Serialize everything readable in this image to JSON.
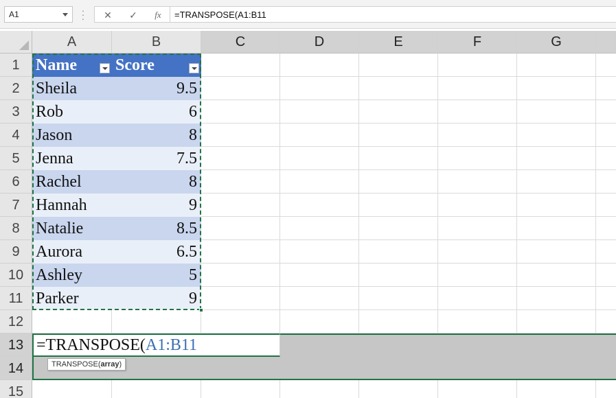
{
  "formula_bar": {
    "name_box": "A1",
    "cancel_icon": "✕",
    "enter_icon": "✓",
    "fx_icon": "fx",
    "formula": "=TRANSPOSE(A1:B11"
  },
  "columns": [
    "A",
    "B",
    "C",
    "D",
    "E",
    "F",
    "G"
  ],
  "rows": [
    "1",
    "2",
    "3",
    "4",
    "5",
    "6",
    "7",
    "8",
    "9",
    "10",
    "11",
    "12",
    "13",
    "14",
    "15"
  ],
  "table": {
    "headers": [
      "Name",
      "Score"
    ],
    "rows": [
      {
        "name": "Sheila",
        "score": "9.5"
      },
      {
        "name": "Rob",
        "score": "6"
      },
      {
        "name": "Jason",
        "score": "8"
      },
      {
        "name": "Jenna",
        "score": "7.5"
      },
      {
        "name": "Rachel",
        "score": "8"
      },
      {
        "name": "Hannah",
        "score": "9"
      },
      {
        "name": "Natalie",
        "score": "8.5"
      },
      {
        "name": "Aurora",
        "score": "6.5"
      },
      {
        "name": "Ashley",
        "score": "5"
      },
      {
        "name": "Parker",
        "score": "9"
      }
    ]
  },
  "editing": {
    "prefix": "=TRANSPOSE(",
    "reference": "A1:B11"
  },
  "tooltip": {
    "func": "TRANSPOSE(",
    "arg": "array",
    "close": ")"
  },
  "colors": {
    "accent": "#217346",
    "table_header": "#4472c4",
    "band_dark": "#c9d6ee",
    "band_light": "#e9eff8",
    "reference": "#3d6fb4"
  }
}
